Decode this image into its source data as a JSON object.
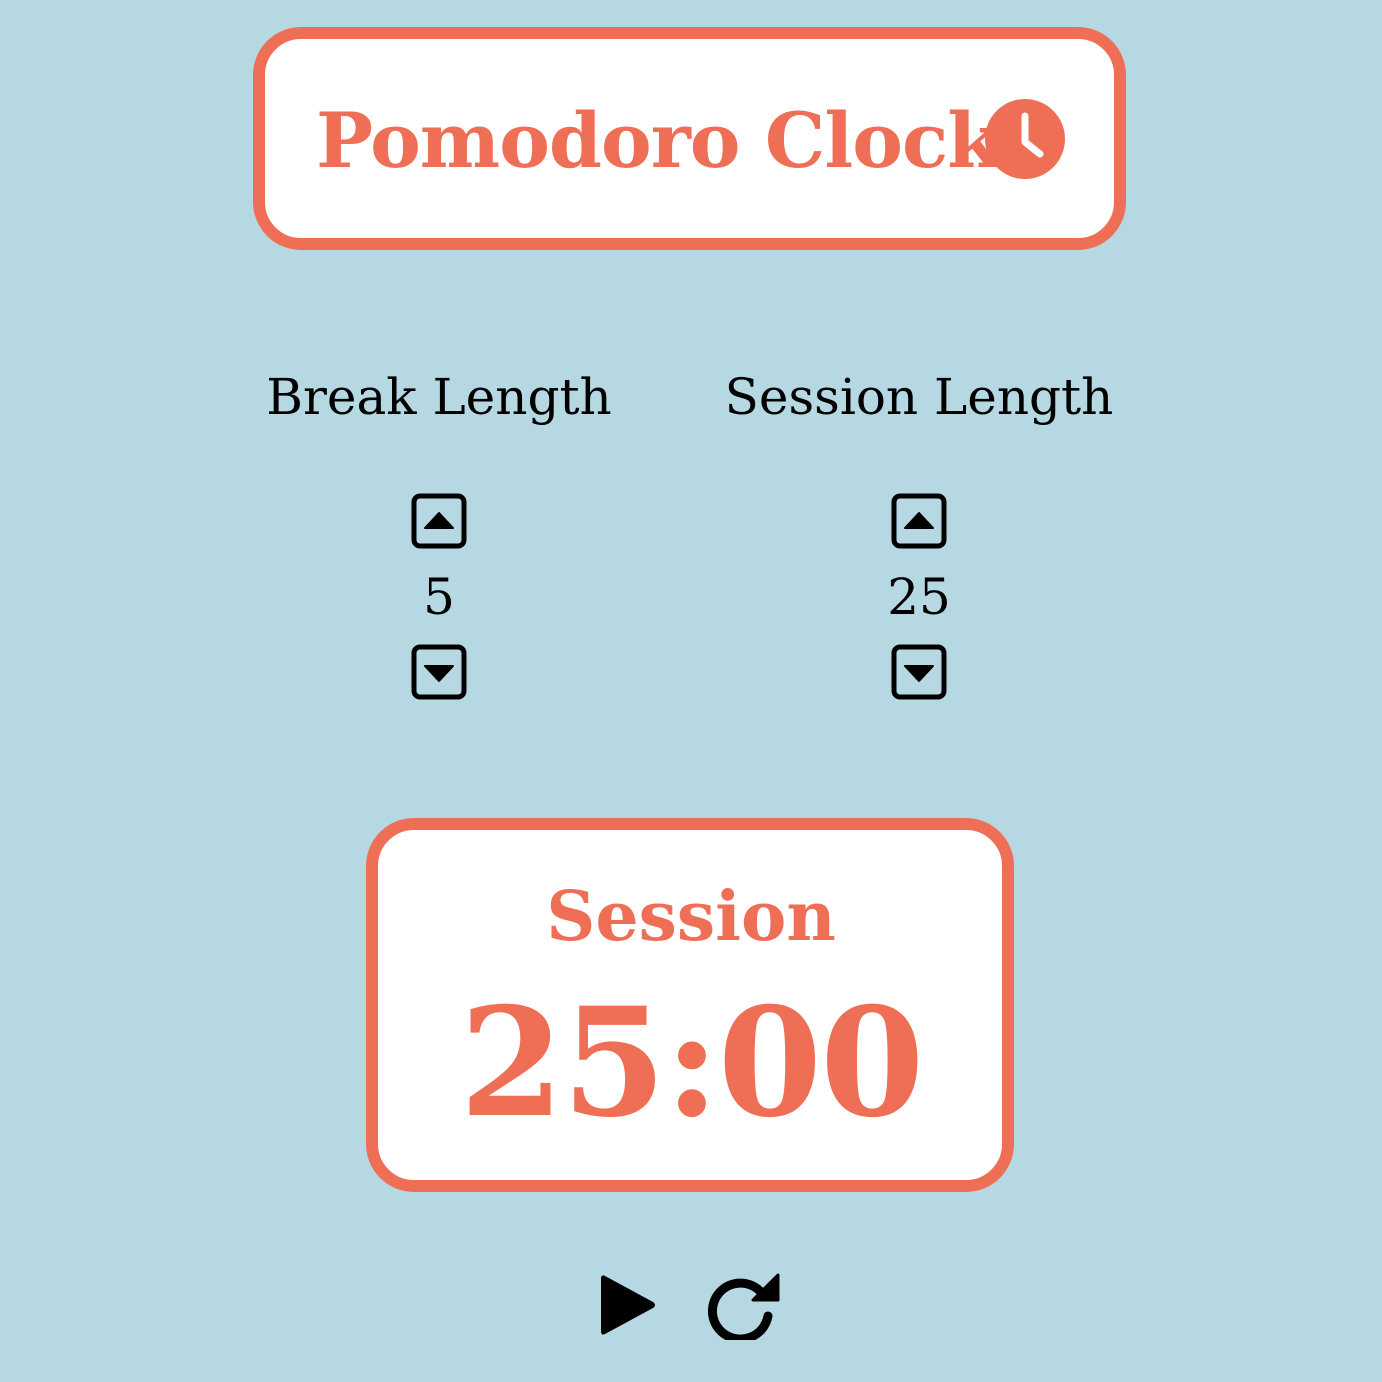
{
  "header": {
    "title": "Pomodoro Clock",
    "icon": "clock-icon"
  },
  "break": {
    "label": "Break Length",
    "value": "5",
    "increment_icon": "caret-square-up-icon",
    "decrement_icon": "caret-square-down-icon"
  },
  "session": {
    "label": "Session Length",
    "value": "25",
    "increment_icon": "caret-square-up-icon",
    "decrement_icon": "caret-square-down-icon"
  },
  "timer": {
    "label": "Session",
    "display": "25:00"
  },
  "controls": {
    "play_icon": "play-icon",
    "reset_icon": "redo-icon"
  },
  "colors": {
    "background": "#b6d8e3",
    "accent": "#ee6f56",
    "card": "#ffffff",
    "text": "#000000"
  }
}
